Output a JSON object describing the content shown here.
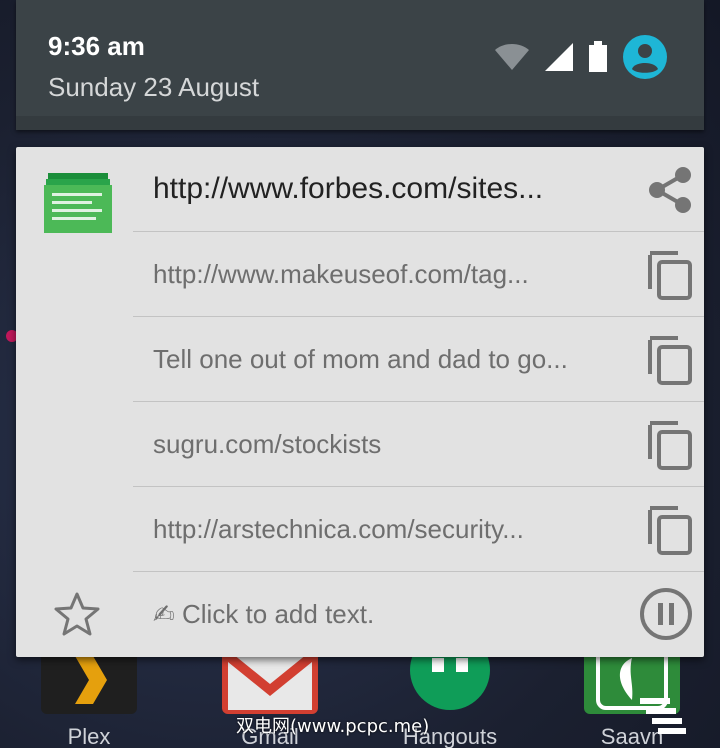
{
  "status_bar": {
    "time": "9:36 am",
    "date": "Sunday 23 August",
    "icons": [
      "wifi-icon",
      "signal-icon",
      "battery-icon",
      "account-icon"
    ],
    "account_color": "#1eb6d6"
  },
  "clipboard": {
    "app_icon": "clipboard-list-icon",
    "items": [
      {
        "text": "http://www.forbes.com/sites...",
        "action": "share-icon"
      },
      {
        "text": "http://www.makeuseof.com/tag...",
        "action": "copy-icon"
      },
      {
        "text": "Tell one out of mom and dad to go...",
        "action": "copy-icon"
      },
      {
        "text": "sugru.com/stockists",
        "action": "copy-icon"
      },
      {
        "text": "http://arstechnica.com/security...",
        "action": "copy-icon"
      }
    ],
    "add_text": "✍ Click to add text.",
    "star_icon": "star-outline-icon",
    "pause_icon": "pause-circle-icon"
  },
  "dock": {
    "apps": [
      {
        "label": "Plex",
        "color": "#1f1f1f"
      },
      {
        "label": "Gmail",
        "color": "#d23f31"
      },
      {
        "label": "Hangouts",
        "color": "#0f9d58"
      },
      {
        "label": "Saavn",
        "color": "#2e8b3a"
      }
    ]
  },
  "watermark": {
    "text": "双电网(www.pcpc.me)"
  }
}
